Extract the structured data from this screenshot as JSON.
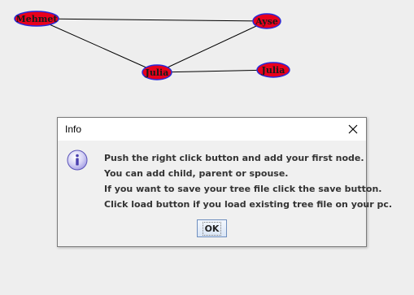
{
  "graph": {
    "nodes": [
      {
        "id": "mehmet",
        "label": "Mehmet"
      },
      {
        "id": "ayse",
        "label": "Ayse"
      },
      {
        "id": "julia1",
        "label": "Julia"
      },
      {
        "id": "julia2",
        "label": "Julia"
      }
    ],
    "edges": [
      [
        "mehmet",
        "ayse"
      ],
      [
        "mehmet",
        "julia1"
      ],
      [
        "ayse",
        "julia1"
      ],
      [
        "julia1",
        "julia2"
      ]
    ],
    "node_fill": "#e8001c",
    "node_stroke": "#2a2ad8",
    "edge_color": "#000000"
  },
  "dialog": {
    "title": "Info",
    "icon": "info-icon",
    "lines": [
      "Push the right click button and add your first node.",
      "You can add child, parent or spouse.",
      "If you want to save your tree file click the save button.",
      "Click load button if you load existing tree file on your pc."
    ],
    "ok_label": "OK"
  }
}
